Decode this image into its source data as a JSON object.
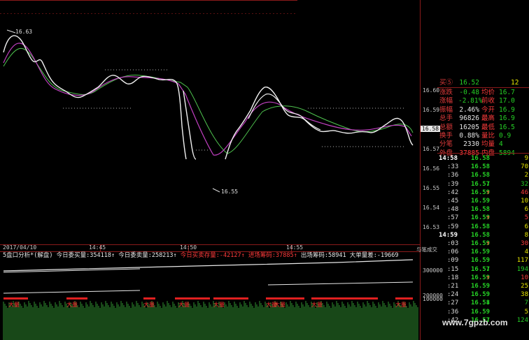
{
  "chart": {
    "price_ticks": [
      "16.60",
      "16.59",
      "16.58",
      "16.57",
      "16.56",
      "16.55",
      "16.54",
      "16.53"
    ],
    "current_price_tag": "16.58",
    "high_label": "16.63",
    "low_label": "16.55",
    "date_label": "2017/04/10",
    "time_ticks": [
      "14:45",
      "14:50",
      "14:55"
    ]
  },
  "indicator": {
    "title": "5盘口分析*(解盘)",
    "buy_pending_label": "今日委买量:",
    "buy_pending_value": "354118",
    "sell_pending_label": "今日委卖量:",
    "sell_pending_value": "258213",
    "net_inventory_label": "今日买卖存量:",
    "net_inventory_value": "-42127",
    "inflow_label": "进场筹码:",
    "inflow_value": "37885",
    "outflow_label": "出场筹码:",
    "outflow_value": "58941",
    "big_order_label": "大单量差:",
    "big_order_value": "-19669",
    "axis_ticks": [
      "300000",
      "200000",
      "100000"
    ],
    "big_volume_label": "大量",
    "right_edge_label": "与笔成交"
  },
  "quote": {
    "buy_header_label": "买⑤",
    "buy_header_price": "16.52",
    "buy_header_vol": "12",
    "rows": [
      {
        "l1": "涨跌",
        "v1": "-0.48",
        "l2": "均价",
        "v2": "16.7"
      },
      {
        "l1": "涨幅",
        "v1": "-2.81%",
        "l2": "前收",
        "v2": "17.0"
      },
      {
        "l1": "振幅",
        "v1": "2.46%",
        "l2": "今开",
        "v2": "16.9"
      },
      {
        "l1": "总手",
        "v1": "96826",
        "l2": "最高",
        "v2": "16.9"
      },
      {
        "l1": "总额",
        "v1": "16205",
        "l2": "最低",
        "v2": "16.5"
      },
      {
        "l1": "换手",
        "v1": "0.88%",
        "l2": "量比",
        "v2": "0.9"
      },
      {
        "l1": "分笔",
        "v1": "2330",
        "l2": "均量",
        "v2": "4"
      },
      {
        "l1": "外盘",
        "v1": "37885",
        "l2": "内盘",
        "v2": "5894"
      }
    ]
  },
  "trades": [
    {
      "time": "14:58",
      "price": "16.58",
      "arrow": "",
      "vol": "9",
      "hl": true
    },
    {
      "time": ":33",
      "price": "16.58",
      "arrow": "",
      "vol": "70"
    },
    {
      "time": ":36",
      "price": "16.58",
      "arrow": "",
      "vol": "2"
    },
    {
      "time": ":39",
      "price": "16.57",
      "arrow": "↓",
      "vol": "32"
    },
    {
      "time": ":42",
      "price": "16.59",
      "arrow": "↑",
      "vol": "46"
    },
    {
      "time": ":45",
      "price": "16.59",
      "arrow": "",
      "vol": "10"
    },
    {
      "time": ":48",
      "price": "16.58",
      "arrow": "",
      "vol": "6"
    },
    {
      "time": ":57",
      "price": "16.59",
      "arrow": "↑",
      "vol": "5"
    },
    {
      "time": ":59",
      "price": "16.58",
      "arrow": "",
      "vol": "6"
    },
    {
      "time": "14:59",
      "price": "16.58",
      "arrow": "",
      "vol": "8",
      "hl": true
    },
    {
      "time": ":03",
      "price": "16.59",
      "arrow": "↑",
      "vol": "30"
    },
    {
      "time": ":06",
      "price": "16.59",
      "arrow": "",
      "vol": "4"
    },
    {
      "time": ":09",
      "price": "16.59",
      "arrow": "",
      "vol": "117"
    },
    {
      "time": ":15",
      "price": "16.57",
      "arrow": "↓",
      "vol": "194"
    },
    {
      "time": ":18",
      "price": "16.59",
      "arrow": "↑",
      "vol": "10"
    },
    {
      "time": ":21",
      "price": "16.59",
      "arrow": "",
      "vol": "25"
    },
    {
      "time": ":24",
      "price": "16.59",
      "arrow": "",
      "vol": "38"
    },
    {
      "time": ":27",
      "price": "16.58",
      "arrow": "↓",
      "vol": "7"
    },
    {
      "time": ":36",
      "price": "16.59",
      "arrow": "",
      "vol": "5"
    },
    {
      "time": ":42",
      "price": "16.57",
      "arrow": "↓",
      "vol": "124"
    }
  ],
  "watermark": "www.7gpzb.com",
  "colors": {
    "up": "#ff3b3b",
    "down": "#25d025",
    "axis": "#8b1a1a",
    "white_line": "#f0f0f0",
    "magenta_line": "#c040c0",
    "green_line": "#4ec24e"
  }
}
